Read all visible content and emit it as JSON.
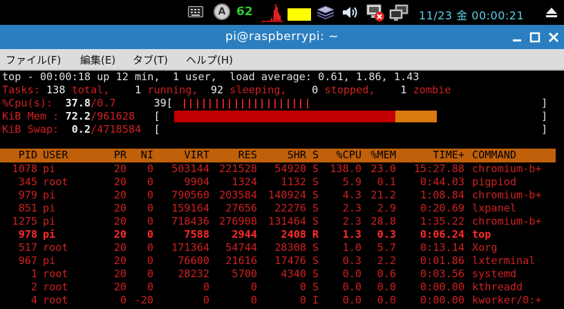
{
  "panel": {
    "keyboard_icon": "keyboard-icon",
    "cpu_icon": "cpu-freq-icon",
    "cpu_letter": "A",
    "temperature": "62",
    "clock": "11/23 金 00:00:21",
    "colors": {
      "temperature": "#2ecc2e",
      "clock": "#5fd0e8",
      "mem_graph": "#ffff00"
    }
  },
  "window": {
    "title": "pi@raspberrypi: ~",
    "menu": [
      "ファイル(F)",
      "編集(E)",
      "タブ(T)",
      "ヘルプ(H)"
    ],
    "titlebar_color": "#2b7fc0"
  },
  "top": {
    "summary": "top - 00:00:18 up 12 min,  1 user,  load average: 0.61, 1.86, 1.43",
    "tasks": {
      "label": "Tasks:",
      "total": "138",
      "total_label": "total,",
      "running": "1",
      "running_label": "running,",
      "sleeping": "92",
      "sleeping_label": "sleeping,",
      "stopped": "0",
      "stopped_label": "stopped,",
      "zombie": "1",
      "zombie_label": "zombie"
    },
    "cpu": {
      "label": "%Cpu(s):",
      "us": "37.8",
      "sy": "/0.7",
      "total": "39",
      "percent": 39
    },
    "mem": {
      "label": "KiB Mem :",
      "used": "72.2",
      "total": "/961628",
      "used_percent": 72.2,
      "cache_percent": 16
    },
    "swap": {
      "label": "KiB Swap:",
      "used": "0.2",
      "total": "/4718584"
    },
    "columns": [
      "PID",
      "USER",
      "PR",
      "NI",
      "VIRT",
      "RES",
      "SHR",
      "S",
      "%CPU",
      "%MEM",
      "TIME+",
      "COMMAND"
    ],
    "processes": [
      [
        "1078",
        "pi",
        "20",
        "0",
        "503144",
        "221528",
        "54920",
        "S",
        "138.0",
        "23.0",
        "15:27.88",
        "chromium-b+"
      ],
      [
        "345",
        "root",
        "20",
        "0",
        "9904",
        "1324",
        "1132",
        "S",
        "5.9",
        "0.1",
        "0:44.03",
        "pigpiod"
      ],
      [
        "979",
        "pi",
        "20",
        "0",
        "790560",
        "203584",
        "140924",
        "S",
        "4.3",
        "21.2",
        "1:08.84",
        "chromium-b+"
      ],
      [
        "851",
        "pi",
        "20",
        "0",
        "159164",
        "27656",
        "22276",
        "S",
        "2.3",
        "2.9",
        "0:20.69",
        "lxpanel"
      ],
      [
        "1275",
        "pi",
        "20",
        "0",
        "718436",
        "276908",
        "131464",
        "S",
        "2.3",
        "28.8",
        "1:35.22",
        "chromium-b+"
      ],
      [
        "978",
        "pi",
        "20",
        "0",
        "7588",
        "2944",
        "2408",
        "R",
        "1.3",
        "0.3",
        "0:06.24",
        "top"
      ],
      [
        "517",
        "root",
        "20",
        "0",
        "171364",
        "54744",
        "28308",
        "S",
        "1.0",
        "5.7",
        "0:13.14",
        "Xorg"
      ],
      [
        "967",
        "pi",
        "20",
        "0",
        "76600",
        "21616",
        "17476",
        "S",
        "0.3",
        "2.2",
        "0:01.86",
        "lxterminal"
      ],
      [
        "1",
        "root",
        "20",
        "0",
        "28232",
        "5700",
        "4340",
        "S",
        "0.0",
        "0.6",
        "0:03.56",
        "systemd"
      ],
      [
        "2",
        "root",
        "20",
        "0",
        "0",
        "0",
        "0",
        "S",
        "0.0",
        "0.0",
        "0:00.00",
        "kthreadd"
      ],
      [
        "4",
        "root",
        "0",
        "-20",
        "0",
        "0",
        "0",
        "I",
        "0.0",
        "0.0",
        "0:00.00",
        "kworker/0:+"
      ]
    ],
    "highlight_pid": "978",
    "colors": {
      "text": "#d02020",
      "header_bg": "#c0600a",
      "mem_used": "#c00000",
      "mem_cache": "#d87a10"
    }
  }
}
